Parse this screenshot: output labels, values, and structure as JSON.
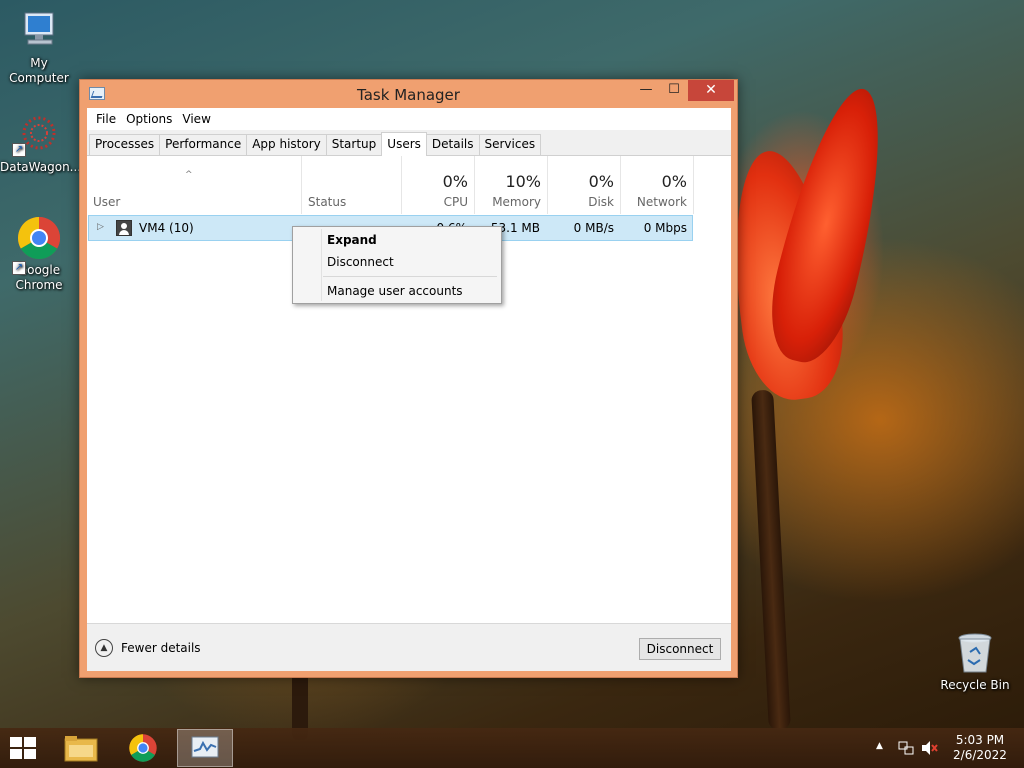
{
  "desktop": {
    "icons": [
      {
        "label": "My Computer"
      },
      {
        "label": "DataWagon..."
      },
      {
        "label": "Google Chrome"
      },
      {
        "label": "Recycle Bin"
      }
    ]
  },
  "window": {
    "title": "Task Manager",
    "controls": {
      "minimize": "—",
      "maximize": "☐",
      "close": "✕"
    },
    "menu": [
      "File",
      "Options",
      "View"
    ],
    "tabs": [
      "Processes",
      "Performance",
      "App history",
      "Startup",
      "Users",
      "Details",
      "Services"
    ],
    "active_tab": "Users",
    "columns": {
      "user": {
        "name": "User",
        "sort_indicator": "^"
      },
      "status": {
        "name": "Status"
      },
      "cpu": {
        "pct": "0%",
        "name": "CPU"
      },
      "memory": {
        "pct": "10%",
        "name": "Memory"
      },
      "disk": {
        "pct": "0%",
        "name": "Disk"
      },
      "network": {
        "pct": "0%",
        "name": "Network"
      }
    },
    "rows": [
      {
        "user": "VM4 (10)",
        "cpu": "0.6%",
        "memory": "53.1 MB",
        "disk": "0 MB/s",
        "network": "0 Mbps"
      }
    ],
    "footer": {
      "fewer_details": "Fewer details",
      "disconnect_button": "Disconnect"
    }
  },
  "context_menu": {
    "items": [
      "Expand",
      "Disconnect",
      "Manage user accounts"
    ],
    "default_item": "Expand"
  },
  "taskbar": {
    "clock_time": "5:03 PM",
    "clock_date": "2/6/2022"
  },
  "colors": {
    "window_frame": "#f0a070",
    "close_button": "#c7463a",
    "row_selected": "#cde8f7"
  }
}
